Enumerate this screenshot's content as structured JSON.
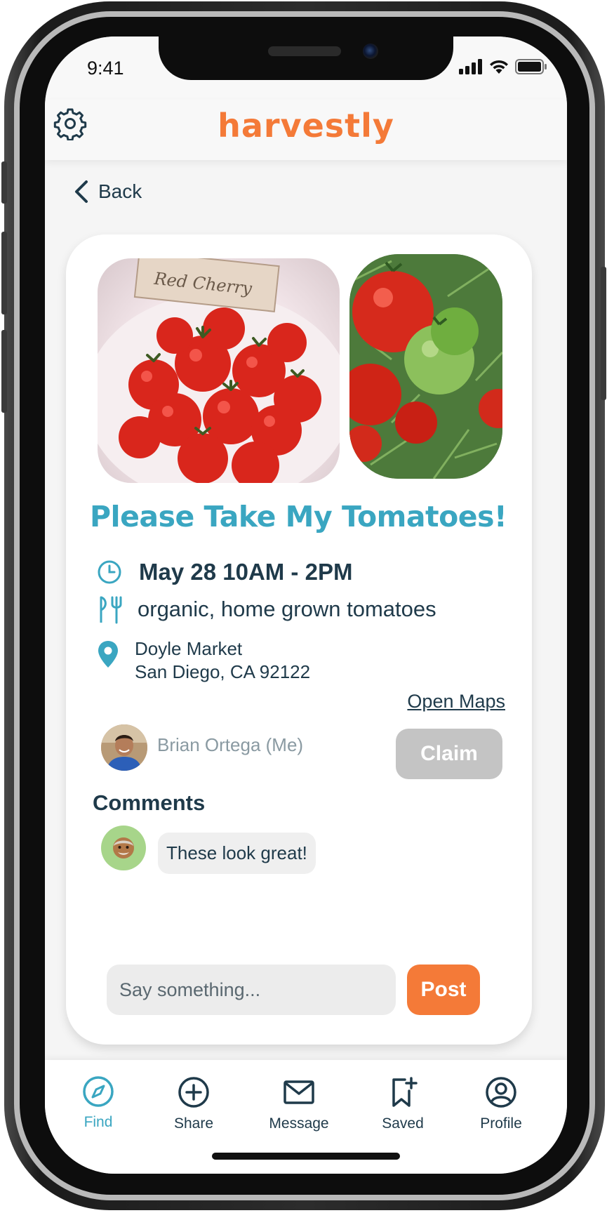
{
  "status_bar": {
    "time": "9:41"
  },
  "header": {
    "logo": "harvestly",
    "settings_icon": "gear-icon"
  },
  "back": {
    "label": "Back"
  },
  "post": {
    "title": "Please Take My Tomatoes!",
    "photos": [
      "cherry-tomatoes-photo",
      "tomato-vine-photo"
    ],
    "photo_label_text": "Red Cherry",
    "time": "May 28 10AM - 2PM",
    "description": "organic, home grown tomatoes",
    "location_name": "Doyle Market",
    "location_address": "San Diego, CA 92122",
    "open_maps_label": "Open Maps",
    "author": "Brian Ortega (Me)",
    "claim_label": "Claim"
  },
  "comments": {
    "heading": "Comments",
    "items": [
      {
        "text": "These look great!",
        "avatar": "person-emoji-avatar"
      }
    ],
    "input_placeholder": "Say something...",
    "post_label": "Post"
  },
  "nav": {
    "items": [
      {
        "label": "Find",
        "icon": "compass-icon",
        "active": true
      },
      {
        "label": "Share",
        "icon": "plus-circle-icon",
        "active": false
      },
      {
        "label": "Message",
        "icon": "envelope-icon",
        "active": false
      },
      {
        "label": "Saved",
        "icon": "bookmark-plus-icon",
        "active": false
      },
      {
        "label": "Profile",
        "icon": "user-circle-icon",
        "active": false
      }
    ]
  },
  "colors": {
    "brand_orange": "#f47a38",
    "accent_teal": "#3aa6c1",
    "text_dark": "#1f3a4a",
    "disabled_gray": "#c4c4c4"
  }
}
